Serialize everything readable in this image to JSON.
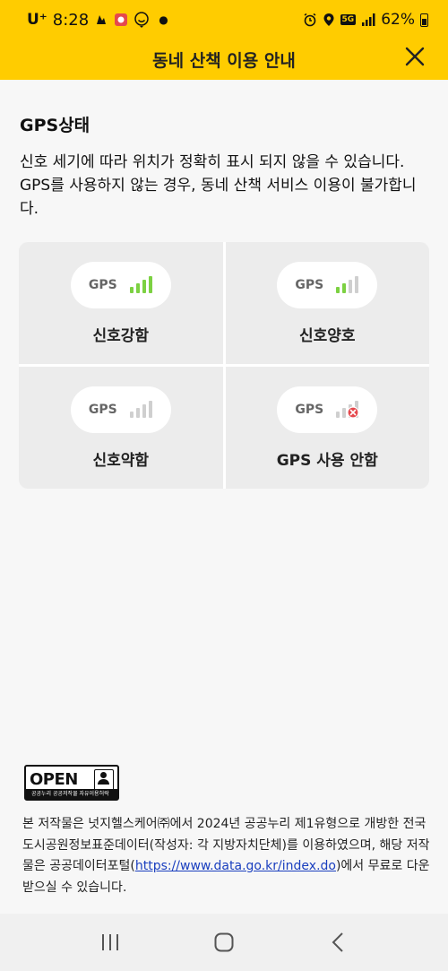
{
  "status_bar": {
    "carrier": "U⁺",
    "time": "8:28",
    "battery": "62%",
    "network_badge": "5G",
    "icons": [
      "notification-app-icon",
      "shield-app-icon",
      "location-smile-icon",
      "alarm-icon",
      "location-icon",
      "signal-icon",
      "battery-icon"
    ]
  },
  "header": {
    "title": "동네 산책 이용 안내",
    "close_icon": "close-icon",
    "background": "#ffcc00"
  },
  "section": {
    "title": "GPS상태",
    "description": "신호 세기에 따라 위치가 정확히 표시 되지 않을 수 있습니다. GPS를 사용하지 않는 경우, 동네 산책 서비스 이용이 불가합니다."
  },
  "gps_states": [
    {
      "pill_label": "GPS",
      "label": "신호강함",
      "bars_active": 4,
      "color": "#7cd142"
    },
    {
      "pill_label": "GPS",
      "label": "신호양호",
      "bars_active": 2,
      "color": "#7cd142"
    },
    {
      "pill_label": "GPS",
      "label": "신호약함",
      "bars_active": 0,
      "color": "#7cd142"
    },
    {
      "pill_label": "GPS",
      "label": "GPS 사용 안함",
      "bars_active": 0,
      "color": "#e5484d",
      "disabled": true
    }
  ],
  "license": {
    "open_logo_text": "OPEN",
    "open_logo_sub": "공공누리  공공저작물 자유이용허락",
    "text_before_link": "본 저작물은 넛지헬스케어㈜에서 2024년 공공누리 제1유형으로 개방한 전국도시공원정보표준데이터(작성자: 각 지방자치단체)를 이용하였으며, 해당 저작물은 공공데이터포털(",
    "link": "https://www.data.go.kr/index.do",
    "text_after_link": ")에서 무료로 다운받으실 수 있습니다."
  },
  "nav": {
    "recent_icon": "recent-apps-icon",
    "home_icon": "home-icon",
    "back_icon": "back-icon"
  }
}
